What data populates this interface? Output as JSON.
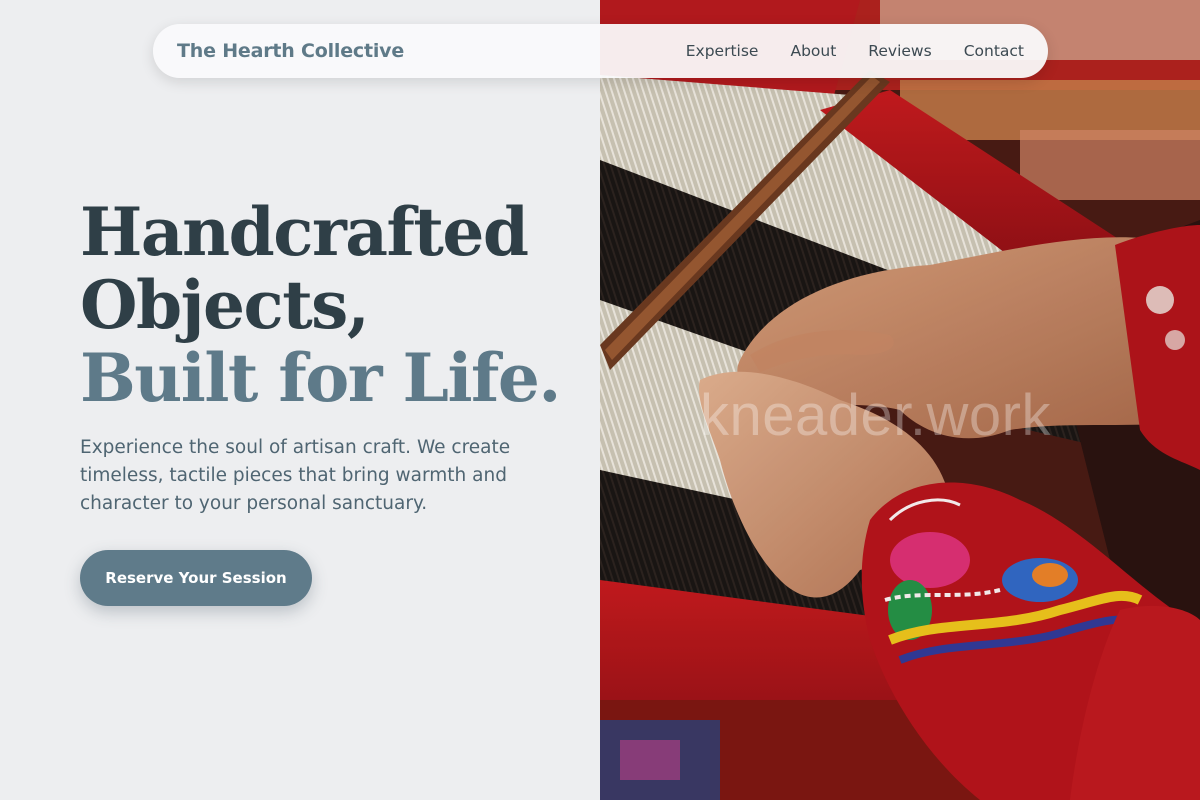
{
  "nav": {
    "brand": "The Hearth Collective",
    "links": [
      {
        "label": "Expertise"
      },
      {
        "label": "About"
      },
      {
        "label": "Reviews"
      },
      {
        "label": "Contact"
      }
    ]
  },
  "hero": {
    "headline_line1": "Handcrafted",
    "headline_line2": "Objects,",
    "headline_accent": "Built for Life.",
    "description": "Experience the soul of artisan craft. We create timeless, tactile pieces that bring warmth and character to your personal sanctuary.",
    "cta_label": "Reserve Your Session"
  },
  "image": {
    "subject": "hands weaving on a backstrap loom with red embroidered sleeve",
    "watermark": "kneader.work"
  },
  "colors": {
    "background": "#edeef0",
    "heading": "#2f3f47",
    "accent": "#5e7a89",
    "body_text": "#4f6572",
    "button": "#5f7b8a"
  }
}
